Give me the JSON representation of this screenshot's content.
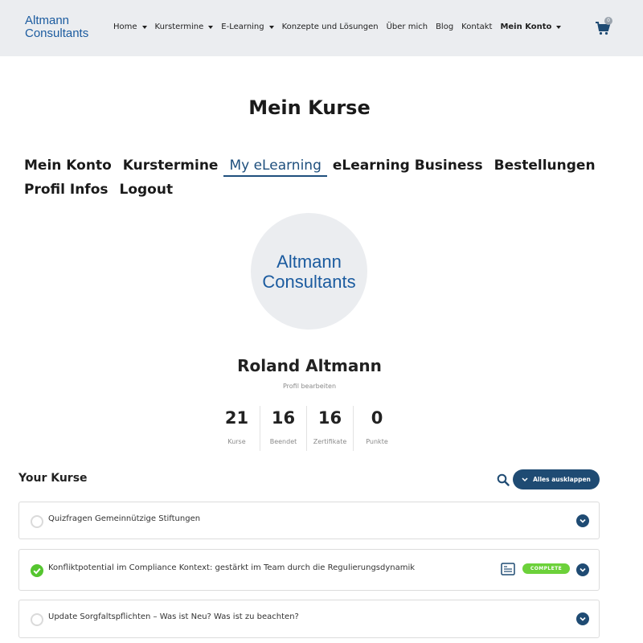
{
  "brand": {
    "logo_line1": "Altmann",
    "logo_line2": "Consultants",
    "color": "#1b5b9f"
  },
  "nav": {
    "items": [
      {
        "label": "Home",
        "dropdown": true
      },
      {
        "label": "Kurstermine",
        "dropdown": true
      },
      {
        "label": "E-Learning",
        "dropdown": true
      },
      {
        "label": "Konzepte und Lösungen",
        "dropdown": false
      },
      {
        "label": "Über mich",
        "dropdown": false
      },
      {
        "label": "Blog",
        "dropdown": false
      },
      {
        "label": "Kontakt",
        "dropdown": false
      },
      {
        "label": "Mein Konto",
        "dropdown": true
      }
    ],
    "cart_icon": "cart-icon",
    "cart_count": "0"
  },
  "page": {
    "title": "Mein Kurse"
  },
  "account_menu": {
    "row1": [
      "Mein Konto",
      "Kurstermine",
      "My eLearning",
      "eLearning Business",
      "Bestellungen"
    ],
    "row2": [
      "Profil Infos",
      "Logout"
    ],
    "active": "My eLearning",
    "accent_color": "#1e4f7d"
  },
  "profile": {
    "avatar_line1": "Altmann",
    "avatar_line2": "Consultants",
    "name": "Roland Altmann",
    "edit_label": "Profil bearbeiten"
  },
  "stats": [
    {
      "value": "21",
      "label": "Kurse"
    },
    {
      "value": "16",
      "label": "Beendet"
    },
    {
      "value": "16",
      "label": "Zertifikate"
    },
    {
      "value": "0",
      "label": "Punkte"
    }
  ],
  "courses_section": {
    "title": "Your Kurse",
    "search_icon": "search-icon",
    "expand_label": "Alles ausklappen",
    "courses": [
      {
        "title": "Quizfragen Gemeinnützige Stiftungen",
        "completed": false
      },
      {
        "title": "Konfliktpotential im Compliance Kontext: gestärkt im Team durch die Regulierungsdynamik",
        "completed": true,
        "badge": "COMPLETE",
        "certificate_icon": "certificate-icon"
      },
      {
        "title": "Update Sorgfaltspflichten – Was ist Neu? Was ist zu beachten?",
        "completed": false
      }
    ],
    "button_color": "#1f4b73",
    "complete_color": "#55c52f"
  }
}
